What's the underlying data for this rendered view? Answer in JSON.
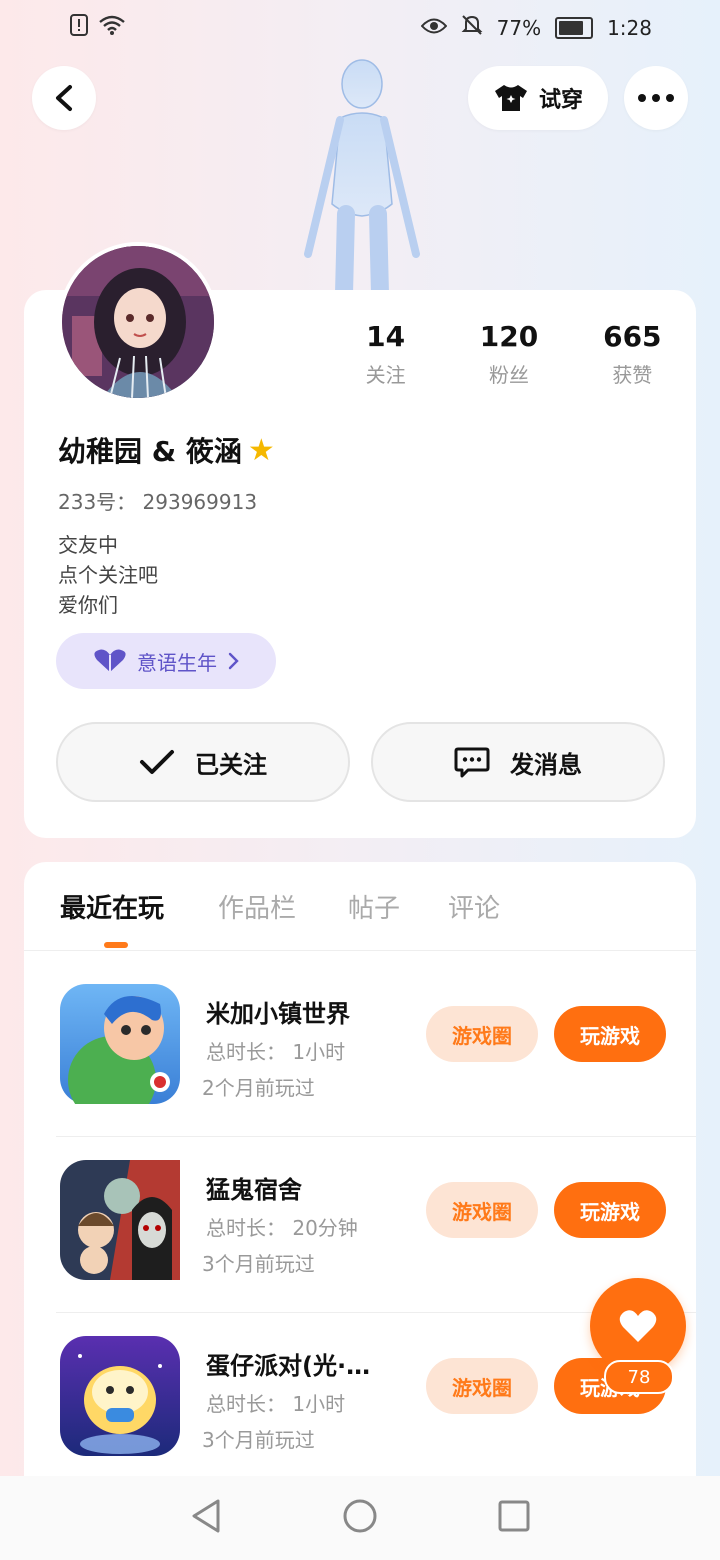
{
  "status_bar": {
    "battery": "77%",
    "time": "1:28"
  },
  "header": {
    "tryon_label": "试穿"
  },
  "profile": {
    "stats": [
      {
        "value": "14",
        "label": "关注"
      },
      {
        "value": "120",
        "label": "粉丝"
      },
      {
        "value": "665",
        "label": "获赞"
      }
    ],
    "nickname": "幼稚园 & 筱涵",
    "uid": "233号： 293969913",
    "bio": [
      "交友中",
      "点个关注吧",
      "爱你们"
    ],
    "tag": "意语生年",
    "follow_label": "已关注",
    "message_label": "发消息"
  },
  "tabs": [
    "最近在玩",
    "作品栏",
    "帖子",
    "评论"
  ],
  "games": [
    {
      "title": "米加小镇世界",
      "duration": "总时长： 1小时",
      "last": "2个月前玩过",
      "circle": "游戏圈",
      "play": "玩游戏"
    },
    {
      "title": "猛鬼宿舍",
      "duration": "总时长： 20分钟",
      "last": "3个月前玩过",
      "circle": "游戏圈",
      "play": "玩游戏"
    },
    {
      "title": "蛋仔派对(光·…",
      "duration": "总时长： 1小时",
      "last": "3个月前玩过",
      "circle": "游戏圈",
      "play": "玩游戏"
    }
  ],
  "like": {
    "count": "78"
  },
  "colors": {
    "accent": "#ff6f10",
    "accent_light": "#fde4d4",
    "tag_bg": "#e8e4fb",
    "tag_text": "#5f54c8"
  },
  "icons": [
    "alert-icon",
    "wifi-icon",
    "eye-icon",
    "mute-icon",
    "battery-icon",
    "back-icon",
    "shirt-icon",
    "more-icon",
    "check-icon",
    "chat-icon",
    "heart-icon",
    "chevron-right-icon",
    "nav-back-icon",
    "nav-home-icon",
    "nav-recent-icon"
  ]
}
